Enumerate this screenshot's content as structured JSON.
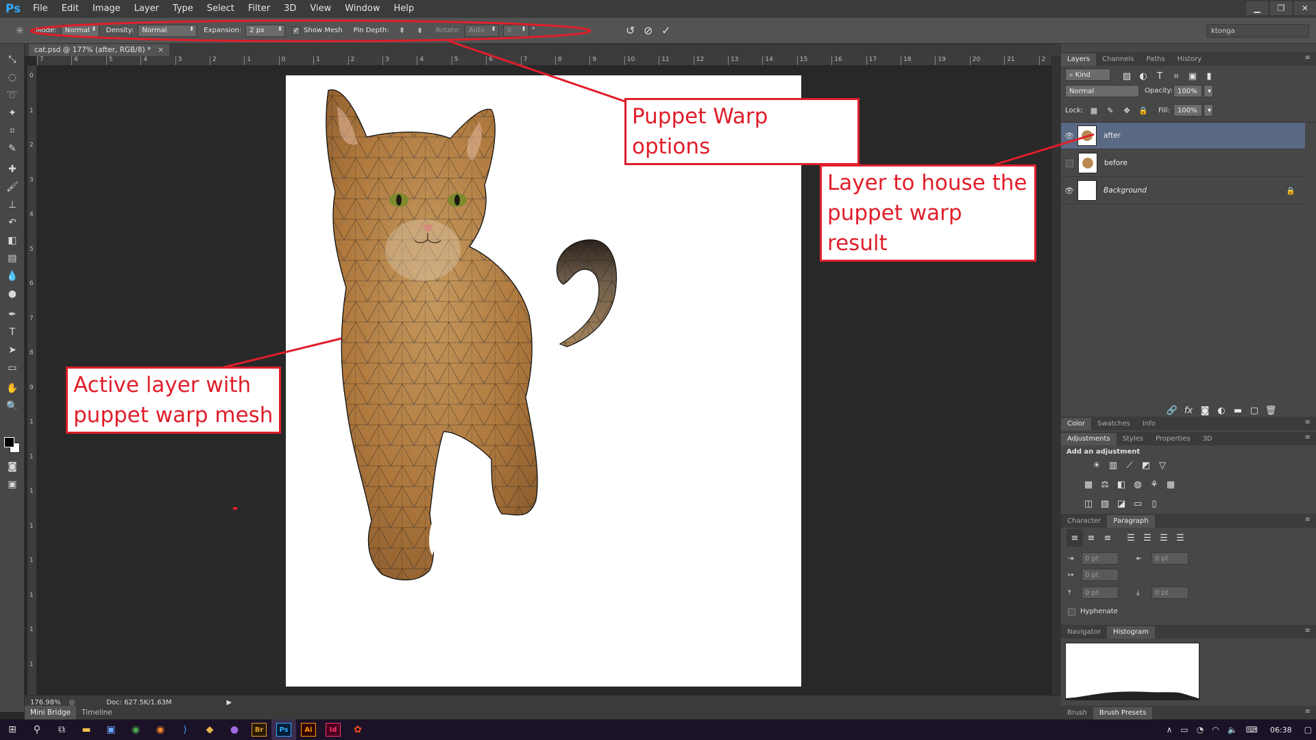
{
  "app": {
    "logo": "Ps",
    "document_tab": "cat.psd @ 177% (after, RGB/8) *"
  },
  "menu": [
    "File",
    "Edit",
    "Image",
    "Layer",
    "Type",
    "Select",
    "Filter",
    "3D",
    "View",
    "Window",
    "Help"
  ],
  "options_bar": {
    "mode_label": "Mode:",
    "mode_value": "Normal",
    "density_label": "Density:",
    "density_value": "Normal",
    "expansion_label": "Expansion:",
    "expansion_value": "2 px",
    "show_mesh_label": "Show Mesh",
    "show_mesh_checked": true,
    "pin_depth_label": "Pin Depth:",
    "rotate_label": "Rotate:",
    "rotate_value": "Auto",
    "rotate_degrees": "0",
    "degree_symbol": "°",
    "workspace_user": "ktonga"
  },
  "rulers": {
    "top": [
      "7",
      "6",
      "5",
      "4",
      "3",
      "2",
      "1",
      "0",
      "1",
      "2",
      "3",
      "4",
      "5",
      "6",
      "7",
      "8",
      "9",
      "10",
      "11",
      "12",
      "13",
      "14",
      "15",
      "16",
      "17",
      "18",
      "19",
      "20",
      "21",
      "2"
    ],
    "left": [
      "0",
      "1",
      "2",
      "3",
      "4",
      "5",
      "6",
      "7",
      "8",
      "9",
      "1",
      "1",
      "1",
      "1",
      "1",
      "1",
      "1",
      "1"
    ]
  },
  "status_bar": {
    "zoom": "176.98%",
    "doc": "Doc: 627.5K/1.63M"
  },
  "bottom_tabs": [
    "Mini Bridge",
    "Timeline"
  ],
  "layers_panel": {
    "tabs": [
      "Layers",
      "Channels",
      "Paths",
      "History"
    ],
    "kind_label": "Kind",
    "blend_mode": "Normal",
    "opacity_label": "Opacity:",
    "opacity_value": "100%",
    "lock_label": "Lock:",
    "fill_label": "Fill:",
    "fill_value": "100%",
    "layers": [
      {
        "name": "after",
        "visible": true,
        "selected": true
      },
      {
        "name": "before",
        "visible": false,
        "selected": false
      },
      {
        "name": "Background",
        "visible": true,
        "selected": false,
        "locked": true
      }
    ]
  },
  "color_panel": {
    "tabs": [
      "Color",
      "Swatches",
      "Info"
    ]
  },
  "adjustments_panel": {
    "tabs": [
      "Adjustments",
      "Styles",
      "Properties",
      "3D"
    ],
    "title": "Add an adjustment"
  },
  "paragraph_panel": {
    "tabs": [
      "Character",
      "Paragraph"
    ],
    "fields": [
      "0 pt",
      "0 pt",
      "0 pt",
      "0 pt",
      "0 pt"
    ],
    "hyphenate_label": "Hyphenate"
  },
  "histogram_panel": {
    "tabs": [
      "Navigator",
      "Histogram"
    ]
  },
  "brush_tabs": [
    "Brush",
    "Brush Presets"
  ],
  "annotations": {
    "puppet_options": "Puppet Warp options",
    "layer_house_1": "Layer to house the",
    "layer_house_2": "puppet warp result",
    "active_layer_1": "Active layer with",
    "active_layer_2": "puppet warp mesh"
  },
  "taskbar": {
    "time": "06:38",
    "app_labels": [
      "Br",
      "Ps",
      "Ai",
      "Id"
    ]
  },
  "colors": {
    "annotation_red": "#e01e2a",
    "selected_layer": "#5a6983",
    "ps_blue": "#31a8ff"
  }
}
